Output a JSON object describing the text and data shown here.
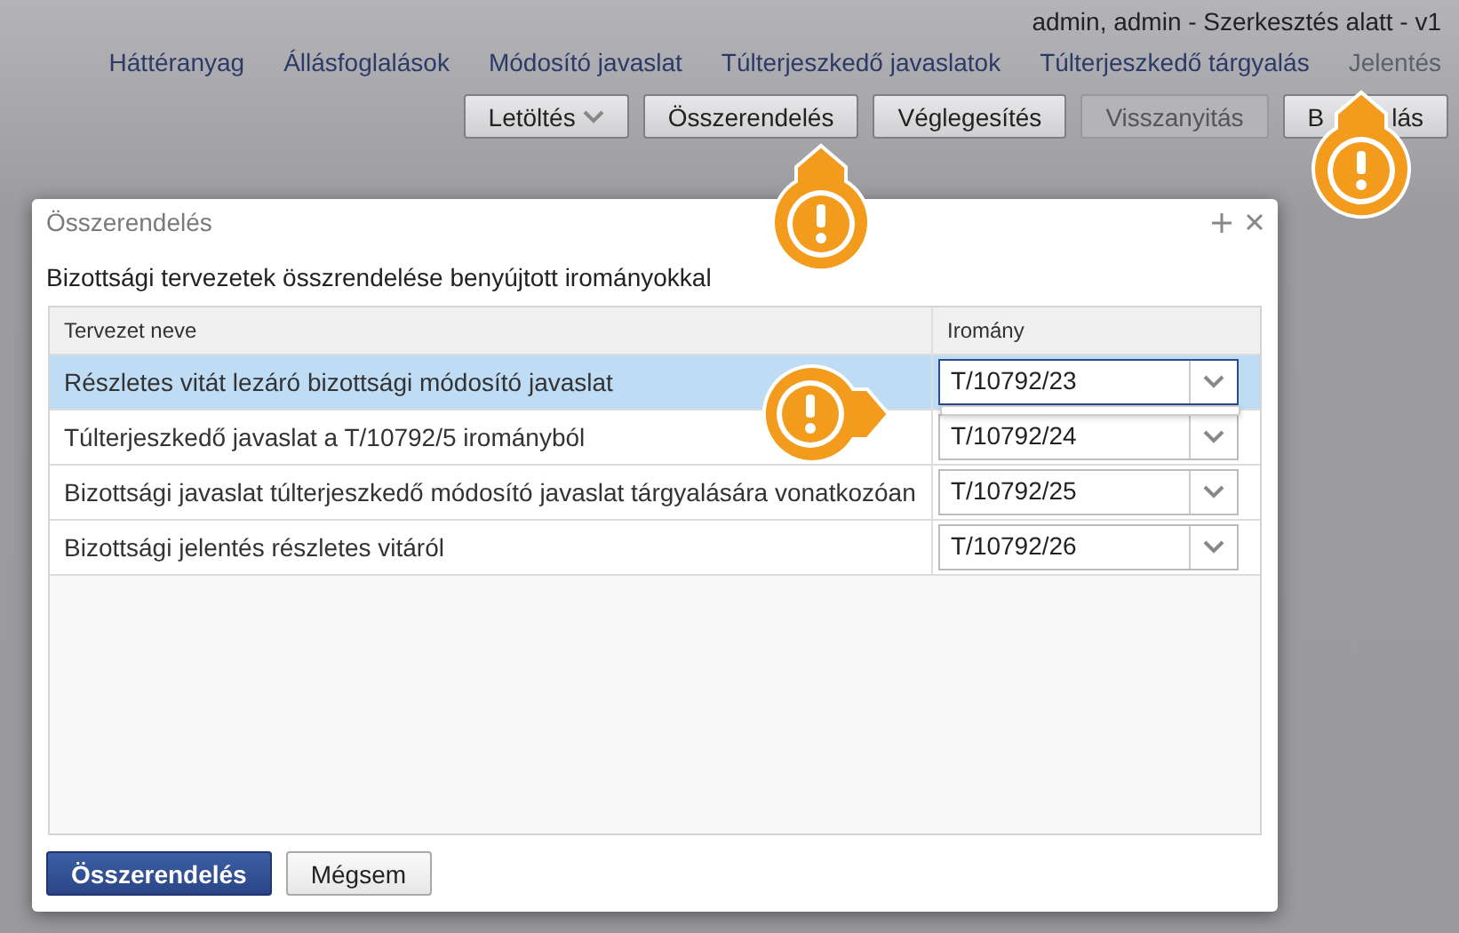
{
  "user_status": "admin, admin - Szerkesztés alatt - v1",
  "nav": [
    {
      "label": "Háttéranyag",
      "disabled": false
    },
    {
      "label": "Állásfoglalások",
      "disabled": false
    },
    {
      "label": "Módosító javaslat",
      "disabled": false
    },
    {
      "label": "Túlterjeszkedő javaslatok",
      "disabled": false
    },
    {
      "label": "Túlterjeszkedő tárgyalás",
      "disabled": false
    },
    {
      "label": "Jelentés",
      "disabled": true
    }
  ],
  "toolbar": [
    {
      "kind": "dropdown",
      "label": "Letöltés",
      "disabled": false
    },
    {
      "kind": "button",
      "label": "Összerendelés",
      "disabled": false
    },
    {
      "kind": "button",
      "label": "Véglegesítés",
      "disabled": false
    },
    {
      "kind": "button",
      "label": "Visszanyitás",
      "disabled": true
    },
    {
      "kind": "split",
      "label": "B",
      "label_end": "lás",
      "disabled": false
    }
  ],
  "dialog": {
    "title": "Összerendelés",
    "subtitle": "Bizottsági tervezetek összrendelése benyújtott irományokkal",
    "columns": [
      "Tervezet neve",
      "Iromány"
    ],
    "rows": [
      {
        "name": "Részletes vitát lezáró bizottsági módosító javaslat",
        "document": "T/10792/23",
        "selected": true,
        "open": true
      },
      {
        "name": "Túlterjeszkedő javaslat a T/10792/5 irományból",
        "document": "T/10792/24",
        "selected": false,
        "open": false
      },
      {
        "name": "Bizottsági javaslat túlterjeszkedő módosító javaslat tárgyalására vonatkozóan",
        "document": "T/10792/25",
        "selected": false,
        "open": false
      },
      {
        "name": "Bizottsági jelentés részletes vitáról",
        "document": "T/10792/26",
        "selected": false,
        "open": false
      }
    ],
    "buttons": [
      {
        "kind": "primary",
        "label": "Összerendelés"
      },
      {
        "kind": "secondary",
        "label": "Mégsem"
      }
    ]
  }
}
